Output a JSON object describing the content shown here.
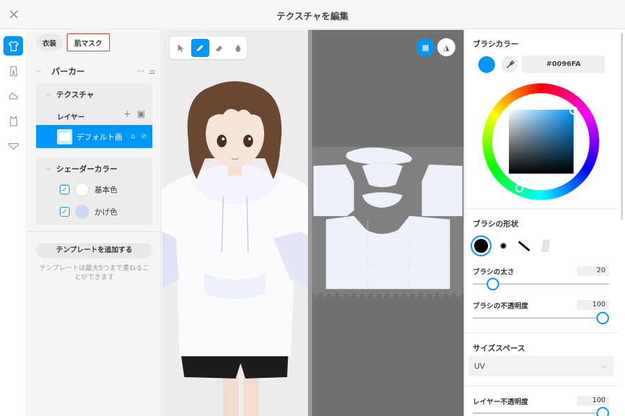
{
  "window": {
    "title": "テクスチャを編集"
  },
  "colors": {
    "accent": "#0096FA",
    "base_color": "#ffffff",
    "shade_color": "#cfd5f5"
  },
  "left": {
    "tabs": [
      {
        "label": "衣装"
      },
      {
        "label": "肌マスク"
      }
    ],
    "group": {
      "label": "パーカー"
    },
    "texture": {
      "label": "テクスチャ",
      "layer_header": "レイヤー",
      "layer": {
        "name": "デフォルト画"
      }
    },
    "shader": {
      "label": "シェーダーカラー",
      "items": [
        {
          "label": "基本色",
          "checked": true
        },
        {
          "label": "かげ色",
          "checked": true
        }
      ]
    },
    "template_button": "テンプレートを追加する",
    "template_note": "テンプレートは最大5つまで重ねることができます"
  },
  "brush": {
    "color_title": "ブラシカラー",
    "hex": "#0096FA",
    "shape_title": "ブラシの形状",
    "size_label": "ブラシの太さ",
    "size_value": "20",
    "opacity_label": "ブラシの不透明度",
    "opacity_value": "100",
    "size_fraction": 0.2,
    "opacity_fraction": 1.0
  },
  "size_space": {
    "title": "サイズスペース",
    "value": "UV"
  },
  "layer_opacity": {
    "label": "レイヤー不透明度",
    "value": "100"
  },
  "icons": {
    "rail": [
      "shirt-icon",
      "pants-icon",
      "shoe-icon",
      "tank-top-icon",
      "underwear-icon"
    ],
    "tools": [
      "cursor-icon",
      "pen-icon",
      "eraser-icon",
      "fill-drop-icon"
    ]
  }
}
